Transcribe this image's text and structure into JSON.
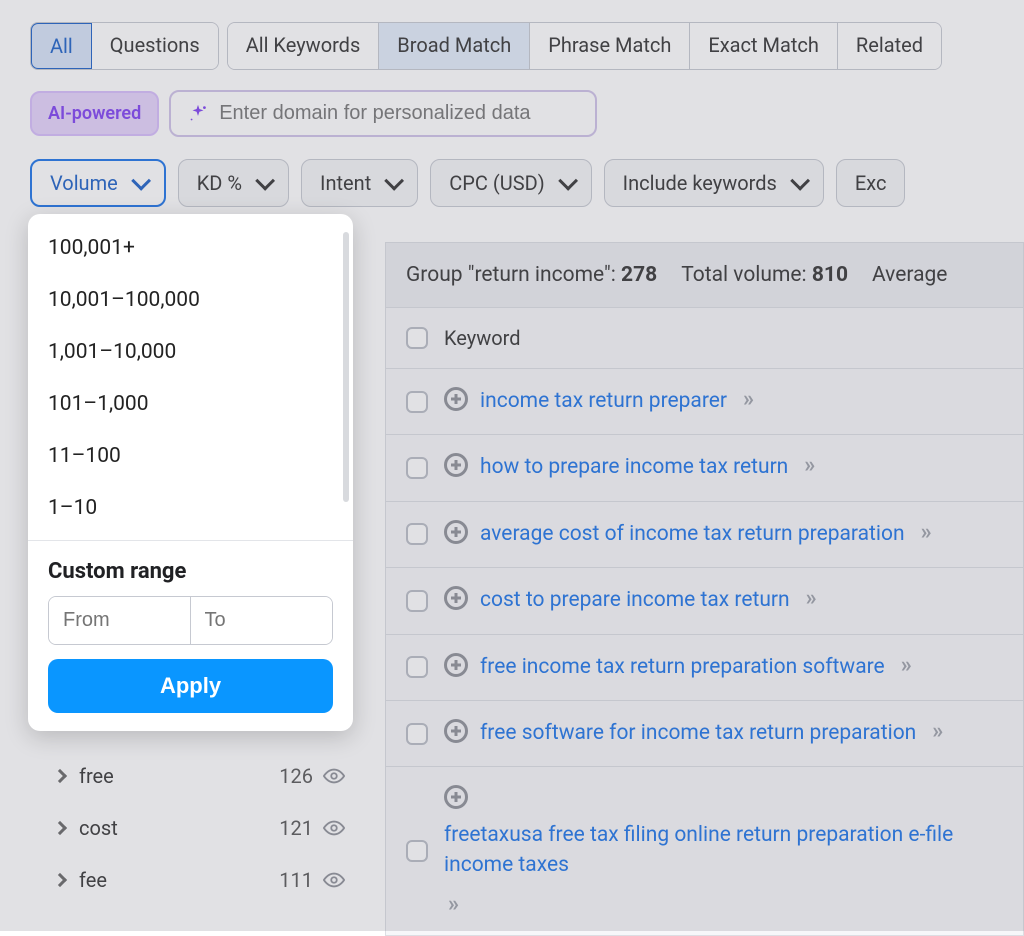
{
  "tabs_group1": [
    {
      "label": "All",
      "active": "blue"
    },
    {
      "label": "Questions",
      "active": ""
    }
  ],
  "tabs_group2": [
    {
      "label": "All Keywords",
      "active": ""
    },
    {
      "label": "Broad Match",
      "active": "pale"
    },
    {
      "label": "Phrase Match",
      "active": ""
    },
    {
      "label": "Exact Match",
      "active": ""
    },
    {
      "label": "Related",
      "active": ""
    }
  ],
  "ai_badge": "AI-powered",
  "ai_placeholder": "Enter domain for personalized data",
  "filters": [
    {
      "label": "Volume",
      "active": true
    },
    {
      "label": "KD %",
      "active": false
    },
    {
      "label": "Intent",
      "active": false
    },
    {
      "label": "CPC (USD)",
      "active": false
    },
    {
      "label": "Include keywords",
      "active": false
    },
    {
      "label": "Exc",
      "active": false
    }
  ],
  "volume_dropdown": {
    "options": [
      "100,001+",
      "10,001–100,000",
      "1,001–10,000",
      "101–1,000",
      "11–100",
      "1–10"
    ],
    "custom_title": "Custom range",
    "from_placeholder": "From",
    "to_placeholder": "To",
    "apply": "Apply"
  },
  "side_groups": [
    {
      "label": "free",
      "count": "126"
    },
    {
      "label": "cost",
      "count": "121"
    },
    {
      "label": "fee",
      "count": "111"
    }
  ],
  "summary": {
    "group_label": "Group \"return income\":",
    "group_count": "278",
    "total_label": "Total volume:",
    "total_value": "810",
    "avg_label": "Average"
  },
  "table_header": "Keyword",
  "keywords": [
    "income tax return preparer",
    "how to prepare income tax return",
    "average cost of income tax return preparation",
    "cost to prepare income tax return",
    "free income tax return preparation software",
    "free software for income tax return preparation",
    "freetaxusa free tax filing online return preparation e-file income taxes"
  ]
}
